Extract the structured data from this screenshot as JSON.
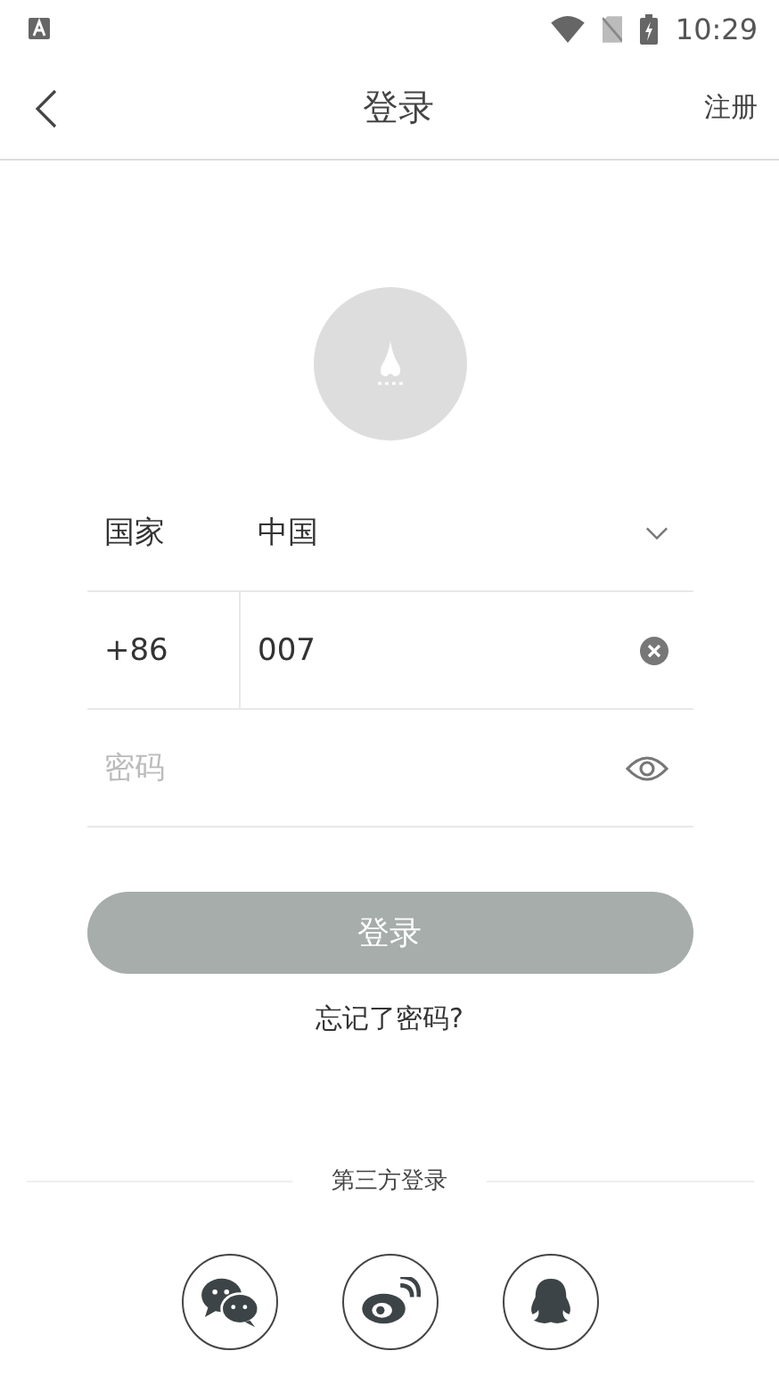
{
  "status_bar": {
    "time": "10:29"
  },
  "header": {
    "title": "登录",
    "action": "注册"
  },
  "form": {
    "country": {
      "label": "国家",
      "value": "中国"
    },
    "phone": {
      "code": "+86",
      "value": "007"
    },
    "password": {
      "placeholder": "密码"
    }
  },
  "login_button": {
    "label": "登录",
    "disabled": true
  },
  "forgot_link": "忘记了密码?",
  "third_party": {
    "title": "第三方登录",
    "providers": [
      {
        "kind": "wechat"
      },
      {
        "kind": "weibo"
      },
      {
        "kind": "qq"
      }
    ]
  }
}
